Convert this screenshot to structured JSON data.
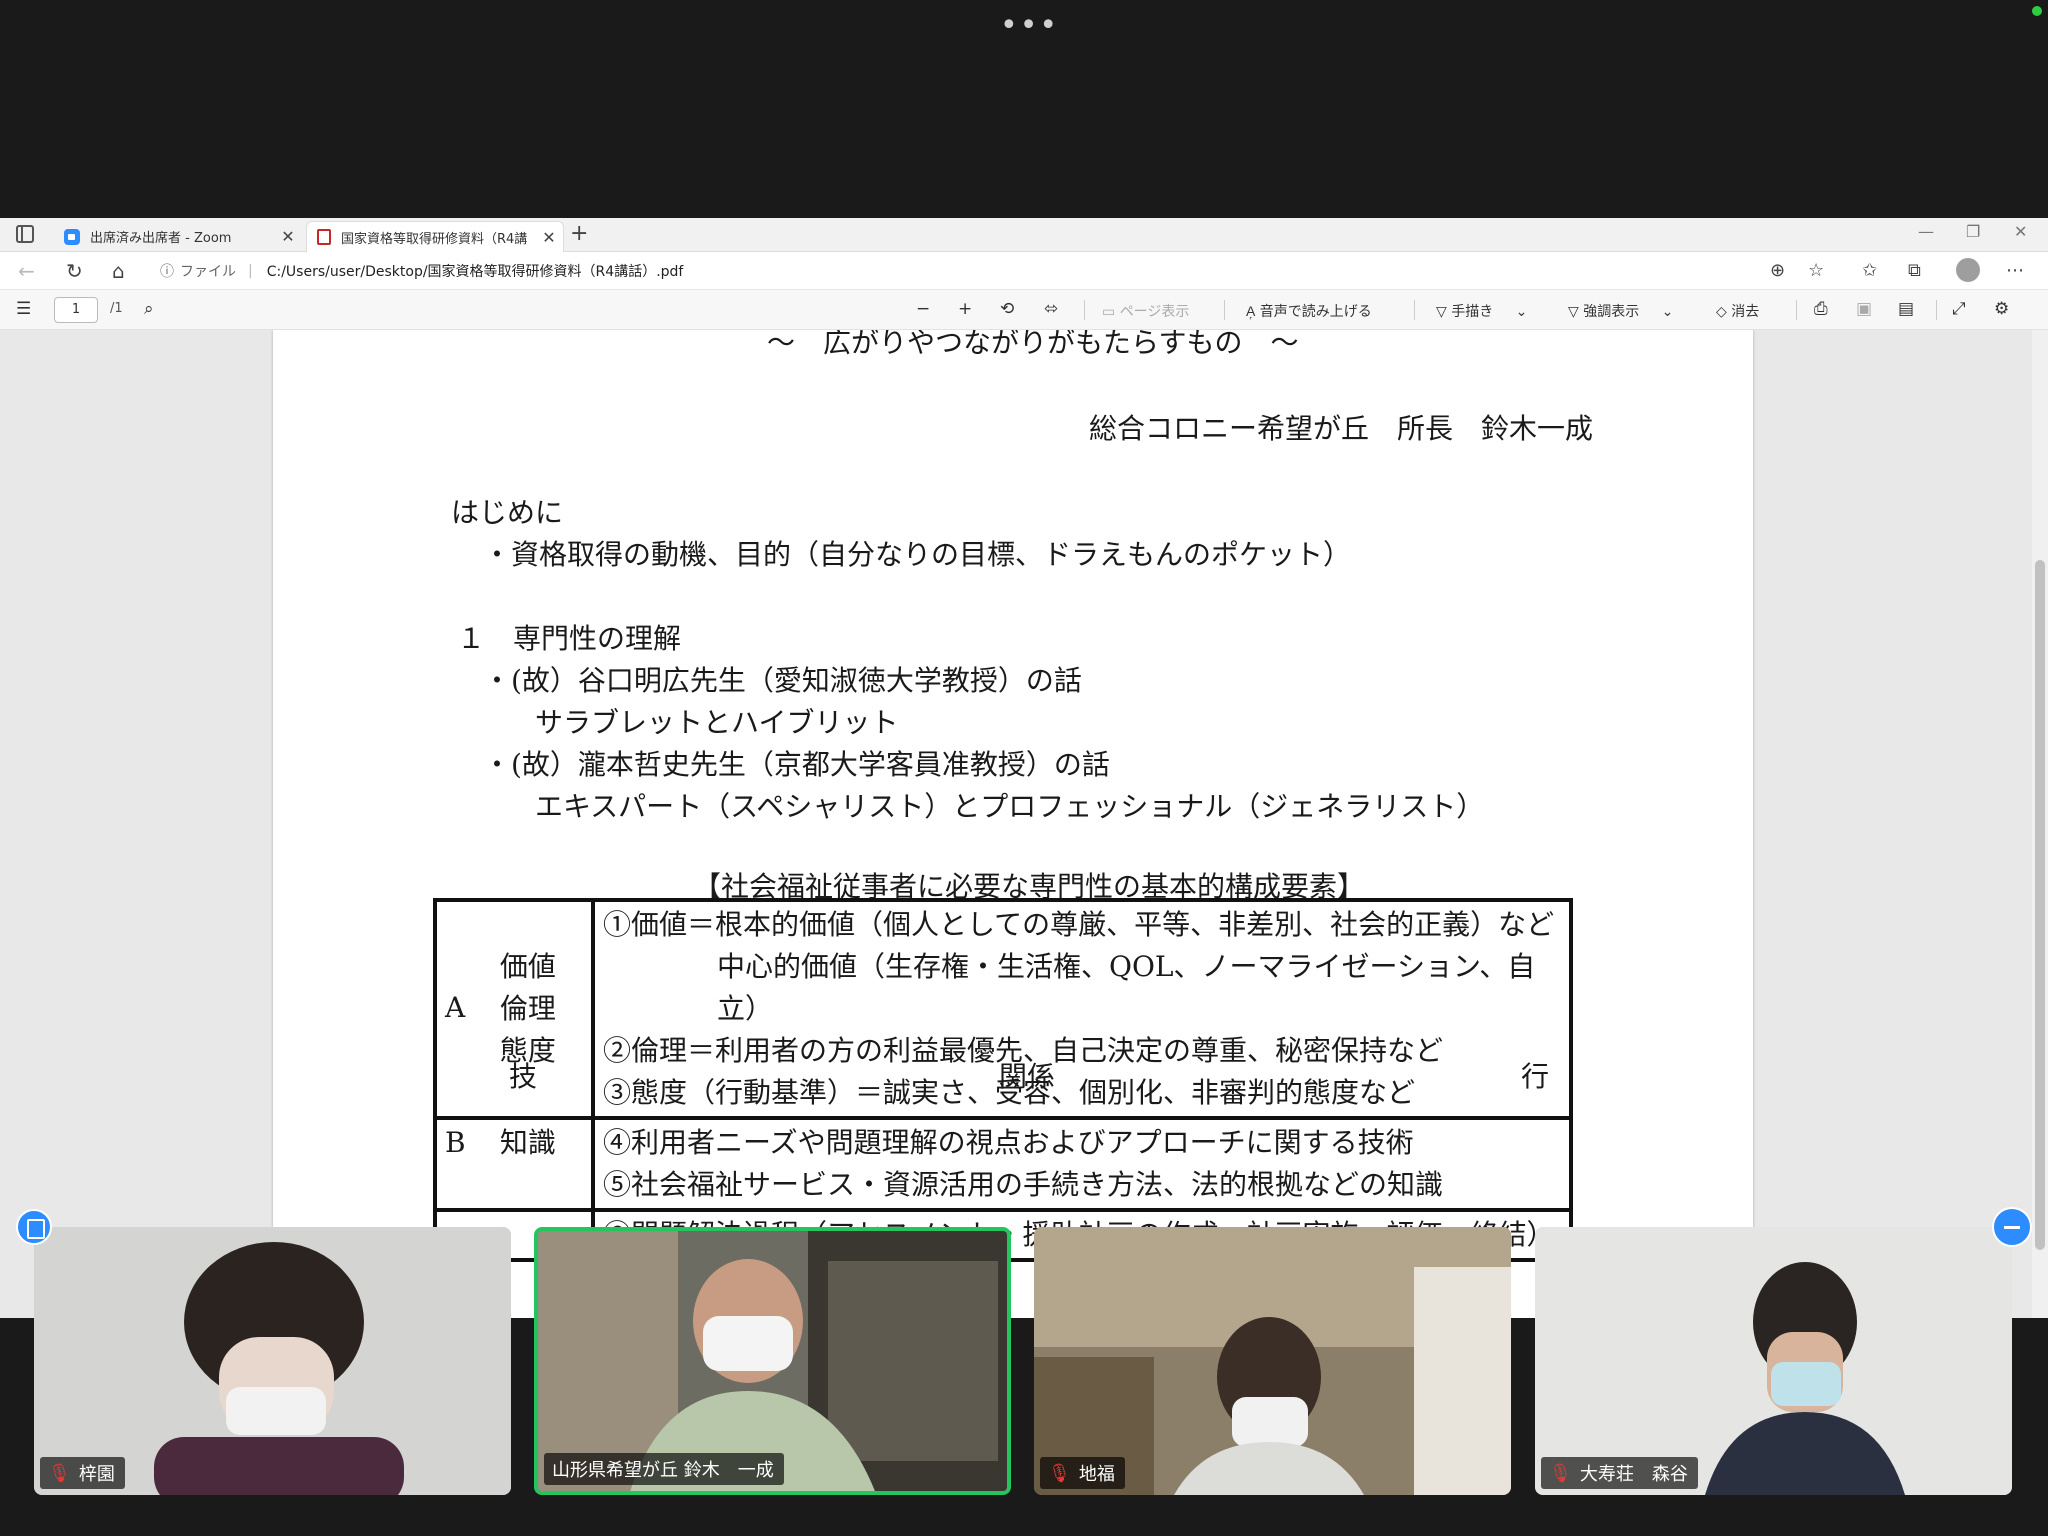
{
  "browser": {
    "tabs": [
      {
        "label": "出席済み出席者 - Zoom",
        "active": false
      },
      {
        "label": "国家資格等取得研修資料（R4講",
        "active": true
      }
    ],
    "address": {
      "scheme_label": "ファイル",
      "url": "C:/Users/user/Desktop/国家資格等取得研修資料（R4講話）.pdf"
    }
  },
  "pdf_toolbar": {
    "page_current": "1",
    "page_total": "/1",
    "page_view": "ページ表示",
    "read_aloud": "音声で読み上げる",
    "draw": "手描き",
    "highlight": "強調表示",
    "erase": "消去"
  },
  "document": {
    "subtitle": "～　広がりやつながりがもたらすもの　～",
    "author": "総合コロニー希望が丘　所長　鈴木一成",
    "intro_heading": "はじめに",
    "intro_bullet": "・資格取得の動機、目的（自分なりの目標、ドラえもんのポケット）",
    "section1_heading": "１　専門性の理解",
    "section1_bullet1": "・(故）谷口明広先生（愛知淑徳大学教授）の話",
    "section1_bullet1_sub": "サラブレットとハイブリット",
    "section1_bullet2": "・(故）瀧本哲史先生（京都大学客員准教授）の話",
    "section1_bullet2_sub": "エキスパート（スペシャリスト）とプロフェッショナル（ジェネラリスト）",
    "table_title": "【社会福祉従事者に必要な専門性の基本的構成要素】",
    "table": {
      "row_a": {
        "letter": "A",
        "words": [
          "価値",
          "倫理",
          "態度"
        ],
        "lines": [
          "①価値＝根本的価値（個人としての尊厳、平等、非差別、社会的正義）など",
          "中心的価値（生存権・生活権、QOL、ノーマライゼーション、自立）",
          "②倫理＝利用者の方の利益最優先、自己決定の尊重、秘密保持など",
          "③態度（行動基準）＝誠実さ、受容、個別化、非審判的態度など"
        ]
      },
      "row_b": {
        "letter": "B",
        "words": [
          "知識"
        ],
        "lines": [
          "④利用者ニーズや問題理解の視点およびアプローチに関する技術",
          "⑤社会福祉サービス・資源活用の手続き方法、法的根拠などの知識"
        ]
      },
      "row_c": {
        "lines": [
          "⑥問題解決過程（アセスメント・援助計画の作成・計画実施・評価・終結）"
        ]
      }
    },
    "obscured_fragments": [
      "技",
      "関係",
      "行"
    ]
  },
  "participants": [
    {
      "name": "梓園",
      "muted": true,
      "speaking": false
    },
    {
      "name": "山形県希望が丘 鈴木　一成",
      "muted": false,
      "speaking": true
    },
    {
      "name": "地福",
      "muted": true,
      "speaking": false
    },
    {
      "name": "大寿荘　森谷",
      "muted": true,
      "speaking": false
    }
  ],
  "colors": {
    "zoom_blue": "#2d8cff",
    "speaker_green": "#22c55e",
    "muted_red": "#e53935"
  }
}
